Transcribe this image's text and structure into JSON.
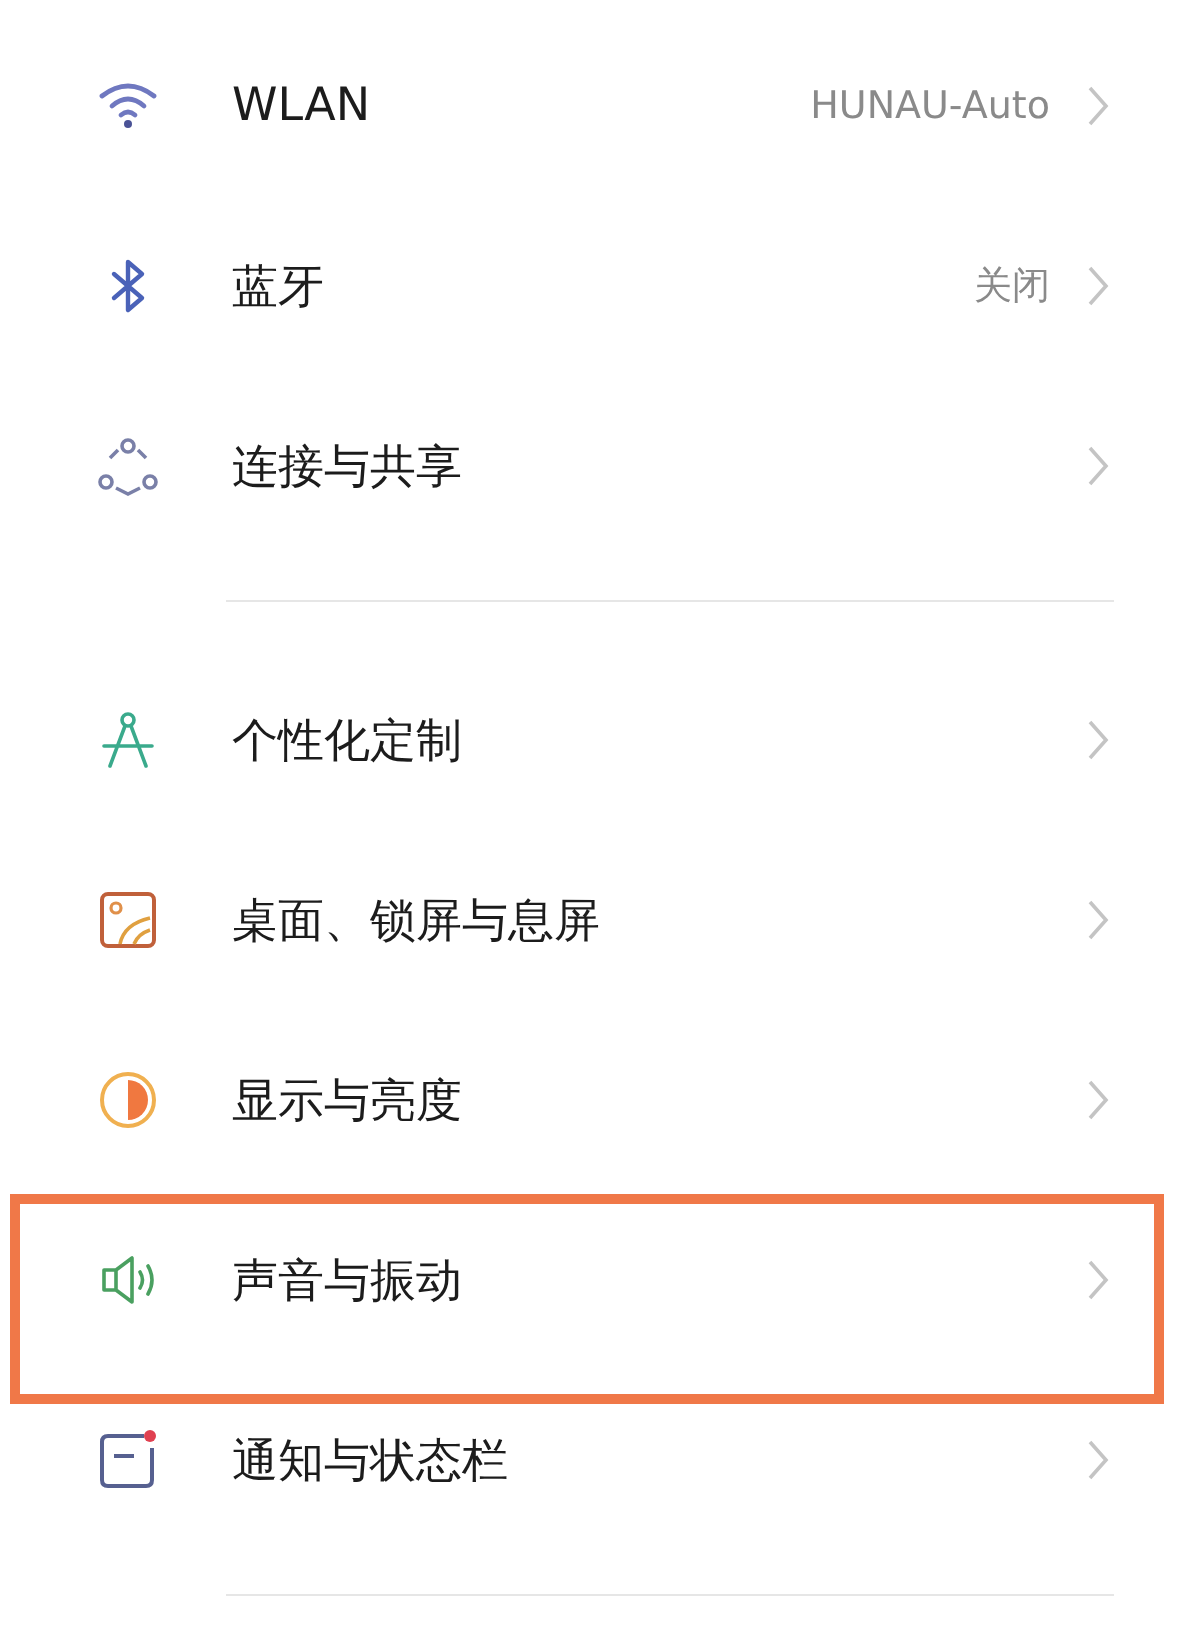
{
  "groups": [
    {
      "items": [
        {
          "label": "WLAN",
          "value": "HUNAU-Auto",
          "highlighted": false
        },
        {
          "label": "蓝牙",
          "value": "关闭",
          "highlighted": false
        },
        {
          "label": "连接与共享",
          "highlighted": false
        }
      ]
    },
    {
      "items": [
        {
          "label": "个性化定制",
          "highlighted": false
        },
        {
          "label": "桌面、锁屏与息屏",
          "highlighted": false
        },
        {
          "label": "显示与亮度",
          "highlighted": false
        },
        {
          "label": "声音与振动",
          "highlighted": true
        },
        {
          "label": "通知与状态栏",
          "highlighted": false
        }
      ]
    }
  ]
}
